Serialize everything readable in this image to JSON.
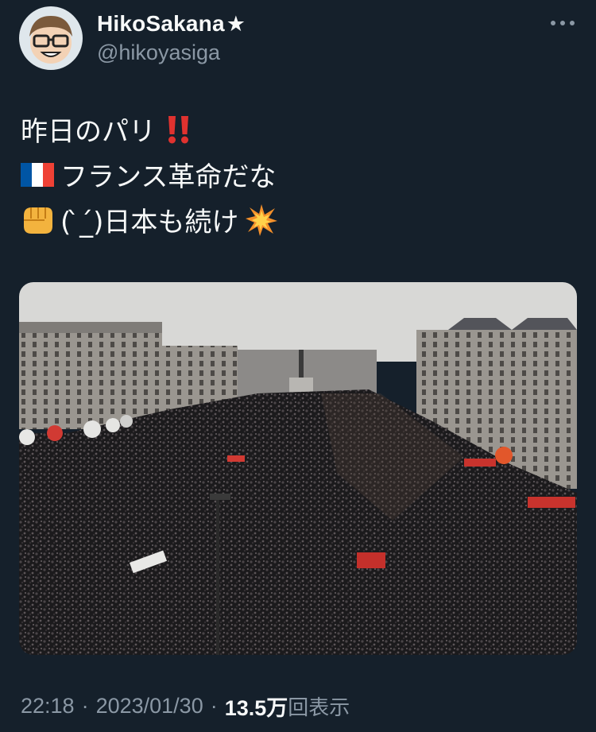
{
  "author": {
    "display_name": "HikoSakana",
    "name_badge": "★",
    "handle": "@hikoyasiga"
  },
  "tweet": {
    "line1_text": "昨日のパリ",
    "line1_emoji": "double-exclamation",
    "line2_emoji": "france-flag",
    "line2_text": "フランス革命だな",
    "line3_emoji": "oncoming-fist",
    "line3_text": "( ̀_́)日本も続け",
    "line3_trailing_emoji": "collision"
  },
  "media": {
    "type": "photo",
    "subject": "aerial-view-of-crowd-in-plaza"
  },
  "meta": {
    "time": "22:18",
    "separator": "·",
    "date": "2023/01/30",
    "view_count": "13.5万",
    "views_label": "回表示"
  },
  "colors": {
    "background": "#15202b",
    "text_primary": "#f7f9f9",
    "text_secondary": "#8b98a5",
    "emoji_red": "#e0322f",
    "emoji_fist": "#f3b33e"
  },
  "icons": {
    "more": "more-horizontal-icon"
  }
}
